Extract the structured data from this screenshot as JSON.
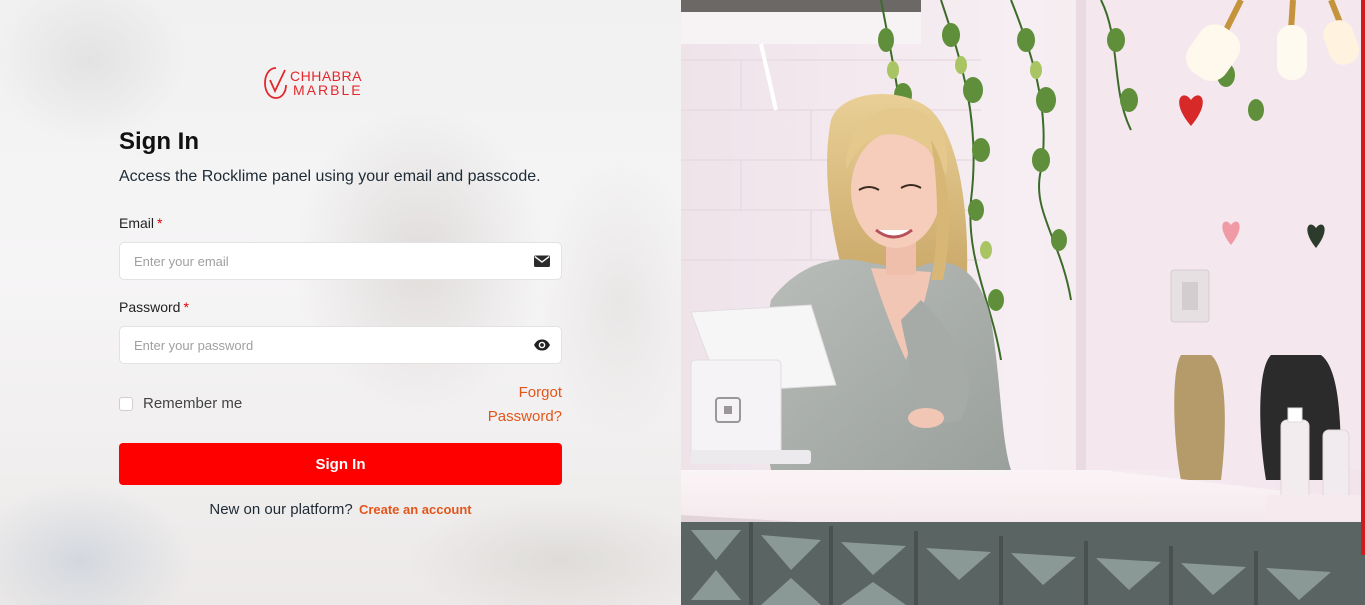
{
  "brand": {
    "line1": "CHHABRA",
    "line2": "MARBLE",
    "color": "#e3282c"
  },
  "form": {
    "title": "Sign In",
    "subtitle": "Access the Rocklime panel using your email and passcode.",
    "email_label": "Email",
    "email_required": "*",
    "email_placeholder": "Enter your email",
    "email_icon": "envelope-icon",
    "password_label": "Password",
    "password_required": "*",
    "password_placeholder": "Enter your password",
    "password_icon": "eye-icon",
    "remember_label": "Remember me",
    "remember_checked": false,
    "forgot_line1": "Forgot",
    "forgot_line2": "Password?",
    "submit_label": "Sign In",
    "signup_prompt": "New on our platform?",
    "signup_link": "Create an account"
  },
  "colors": {
    "primary_button": "#ff0000",
    "link": "#e2561b",
    "required": "#e00000"
  },
  "hero_image": {
    "subject": "woman-at-checkout-counter"
  }
}
